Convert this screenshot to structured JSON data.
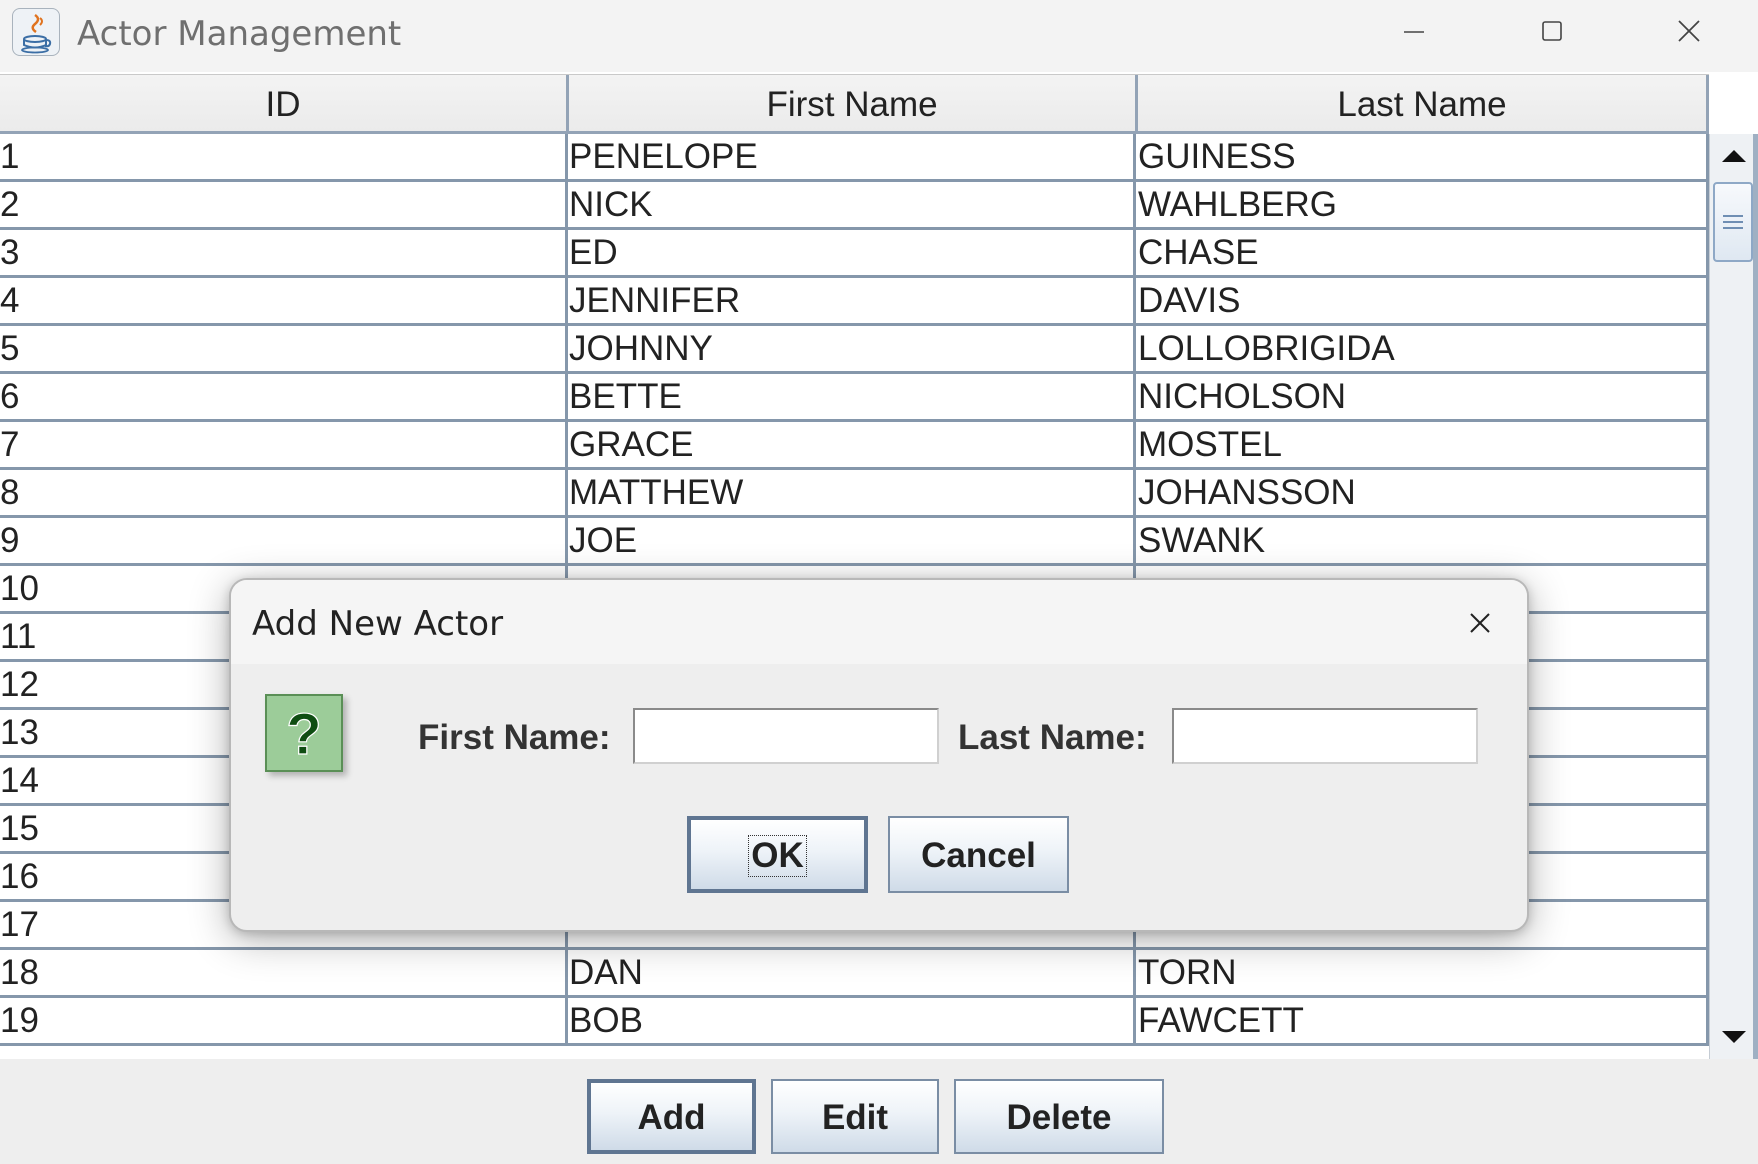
{
  "window": {
    "title": "Actor Management",
    "icon": "java-icon",
    "controls": [
      "minimize-icon",
      "maximize-icon",
      "close-icon"
    ]
  },
  "table": {
    "columns": [
      "ID",
      "First Name",
      "Last Name"
    ],
    "rows": [
      [
        "1",
        "PENELOPE",
        "GUINESS"
      ],
      [
        "2",
        "NICK",
        "WAHLBERG"
      ],
      [
        "3",
        "ED",
        "CHASE"
      ],
      [
        "4",
        "JENNIFER",
        "DAVIS"
      ],
      [
        "5",
        "JOHNNY",
        "LOLLOBRIGIDA"
      ],
      [
        "6",
        "BETTE",
        "NICHOLSON"
      ],
      [
        "7",
        "GRACE",
        "MOSTEL"
      ],
      [
        "8",
        "MATTHEW",
        "JOHANSSON"
      ],
      [
        "9",
        "JOE",
        "SWANK"
      ],
      [
        "10",
        "",
        ""
      ],
      [
        "11",
        "",
        ""
      ],
      [
        "12",
        "",
        ""
      ],
      [
        "13",
        "",
        ""
      ],
      [
        "14",
        "",
        ""
      ],
      [
        "15",
        "",
        ""
      ],
      [
        "16",
        "",
        ""
      ],
      [
        "17",
        "",
        ""
      ],
      [
        "18",
        "DAN",
        "TORN"
      ],
      [
        "19",
        "BOB",
        "FAWCETT"
      ]
    ]
  },
  "buttons": {
    "add": "Add",
    "edit": "Edit",
    "delete": "Delete"
  },
  "dialog": {
    "title": "Add New Actor",
    "icon": "question-icon",
    "first_name_label": "First Name:",
    "last_name_label": "Last Name:",
    "first_name_value": "",
    "last_name_value": "",
    "ok_label": "OK",
    "cancel_label": "Cancel"
  },
  "colors": {
    "grid_line": "#8597ab",
    "button_border": "#7a8da4",
    "question_icon_bg": "#9ccc99"
  }
}
